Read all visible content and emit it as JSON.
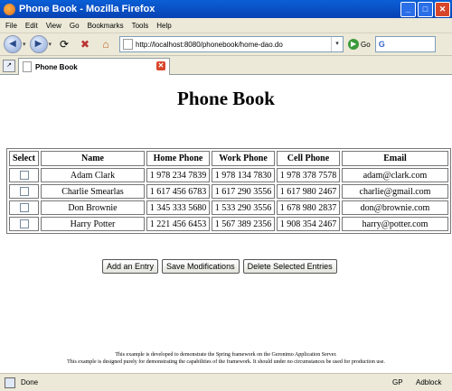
{
  "window": {
    "title": "Phone Book - Mozilla Firefox"
  },
  "menu": [
    "File",
    "Edit",
    "View",
    "Go",
    "Bookmarks",
    "Tools",
    "Help"
  ],
  "address_bar": {
    "url": "http://localhost:8080/phonebook/home-dao.do",
    "go_label": "Go",
    "search_logo": "G"
  },
  "tab": {
    "label": "Phone Book"
  },
  "page": {
    "title": "Phone Book",
    "table": {
      "headers": [
        "Select",
        "Name",
        "Home Phone",
        "Work Phone",
        "Cell Phone",
        "Email"
      ],
      "rows": [
        {
          "name": "Adam Clark",
          "home": "1 978 234 7839",
          "work": "1 978 134 7830",
          "cell": "1 978 378 7578",
          "email": "adam@clark.com"
        },
        {
          "name": "Charlie Smearlas",
          "home": "1 617 456 6783",
          "work": "1 617 290 3556",
          "cell": "1 617 980 2467",
          "email": "charlie@gmail.com"
        },
        {
          "name": "Don Brownie",
          "home": "1 345 333 5680",
          "work": "1 533 290 3556",
          "cell": "1 678 980 2837",
          "email": "don@brownie.com"
        },
        {
          "name": "Harry Potter",
          "home": "1 221 456 6453",
          "work": "1 567 389 2356",
          "cell": "1 908 354 2467",
          "email": "harry@potter.com"
        }
      ]
    },
    "buttons": {
      "add": "Add an Entry",
      "save": "Save Modifications",
      "delete": "Delete Selected Entries"
    },
    "footer": [
      "This example is developed to demonstrate the Spring framework on the Geronimo Application Server.",
      "This example is designed purely for demonstrating the capabilities of the framework. It should under no circumstances be used for production use."
    ]
  },
  "status": {
    "text": "Done",
    "gp": "GP",
    "adblock": "Adblock"
  }
}
